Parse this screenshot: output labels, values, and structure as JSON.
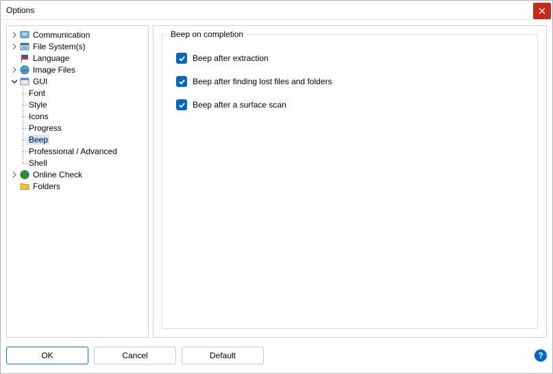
{
  "window": {
    "title": "Options"
  },
  "tree": {
    "items": [
      {
        "label": "Communication"
      },
      {
        "label": "File System(s)"
      },
      {
        "label": "Language"
      },
      {
        "label": "Image Files"
      },
      {
        "label": "GUI"
      },
      {
        "label": "Online Check"
      },
      {
        "label": "Folders"
      }
    ],
    "gui_children": [
      {
        "label": "Font"
      },
      {
        "label": "Style"
      },
      {
        "label": "Icons"
      },
      {
        "label": "Progress"
      },
      {
        "label": "Beep"
      },
      {
        "label": "Professional / Advanced"
      },
      {
        "label": "Shell"
      }
    ]
  },
  "panel": {
    "group_title": "Beep on completion",
    "checks": [
      {
        "label": "Beep after extraction",
        "checked": true
      },
      {
        "label": "Beep after finding lost files and folders",
        "checked": true
      },
      {
        "label": "Beep after a surface scan",
        "checked": true
      }
    ]
  },
  "buttons": {
    "ok": "OK",
    "cancel": "Cancel",
    "default": "Default"
  }
}
